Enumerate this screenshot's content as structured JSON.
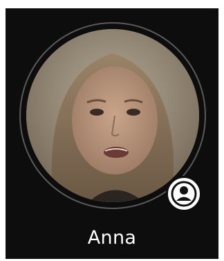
{
  "participant": {
    "name": "Anna",
    "avatar_icon": "participant-photo",
    "badge_icon": "user-profile-icon"
  },
  "colors": {
    "tile_background": "#0d0d0d",
    "ring": "#5a5a5a",
    "name_text": "#ffffff",
    "badge_background": "#ffffff"
  }
}
